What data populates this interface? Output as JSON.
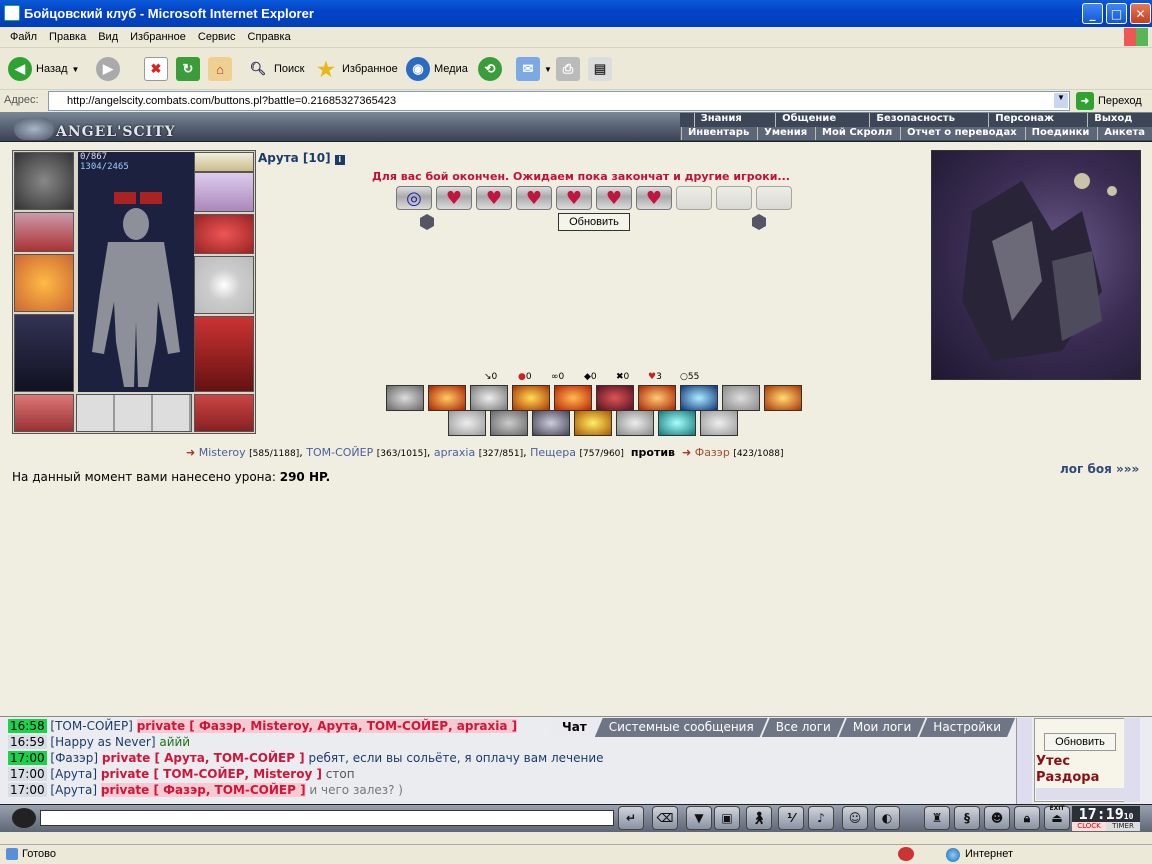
{
  "window": {
    "title": "Бойцовский клуб - Microsoft Internet Explorer"
  },
  "menu": [
    "Файл",
    "Правка",
    "Вид",
    "Избранное",
    "Сервис",
    "Справка"
  ],
  "toolbar": {
    "back": "Назад",
    "search": "Поиск",
    "favorites": "Избранное",
    "media": "Медиа"
  },
  "address": {
    "label": "Адрес:",
    "url": "http://angelscity.combats.com/buttons.pl?battle=0.21685327365423",
    "go": "Переход"
  },
  "game": {
    "logo": "ANGEL'SCITY",
    "nav_top": [
      "Знания",
      "Общение",
      "Безопасность",
      "Персонаж",
      "Выход"
    ],
    "nav_bottom": [
      "Инвентарь",
      "Умения",
      "Мой Скролл",
      "Отчет о переводах",
      "Поединки",
      "Анкета"
    ],
    "hp_line1": "0/867",
    "hp_line2": "1304/2465",
    "character": "Арута [10]",
    "battle_message": "Для вас бой окончен. Ожидаем пока закончат и другие игроки...",
    "refresh": "Обновить",
    "stats": [
      "0",
      "0",
      "0",
      "0",
      "0",
      "3",
      "55"
    ],
    "fighters": {
      "team1": [
        {
          "name": "Misteroy",
          "hp": "[585/1188]"
        },
        {
          "name": "ТОМ-СОЙЕР",
          "hp": "[363/1015]"
        },
        {
          "name": "apraxia",
          "hp": "[327/851]"
        },
        {
          "name": "Пещера",
          "hp": "[757/960]"
        }
      ],
      "vs": "против",
      "team2": [
        {
          "name": "Фазэр",
          "hp": "[423/1088]"
        }
      ]
    },
    "damage_label": "На данный момент вами нанесено урона:",
    "damage_value": "290 HP.",
    "log_link": "лог боя »»»"
  },
  "chat": {
    "tabs": [
      "Чат",
      "Системные сообщения",
      "Все логи",
      "Мои логи",
      "Настройки"
    ],
    "lines": [
      {
        "time": "16:58",
        "name": "[ТОМ-СОЙЕР]",
        "priv": "private [ Фазэр, Misteroy, Арута, ТОМ-СОЙЕР, apraxia ]",
        "text": ""
      },
      {
        "time": "16:59",
        "name": "[Happy as Never]",
        "priv": "",
        "text": "аййй"
      },
      {
        "time": "17:00",
        "name": "[Фазэр]",
        "priv": "private [ Арута, ТОМ-СОЙЕР ]",
        "text": "ребят, если вы сольёте, я оплачу вам лечение"
      },
      {
        "time": "17:00",
        "name": "[Арута]",
        "priv": "private [ ТОМ-СОЙЕР, Misteroy ]",
        "text": "стоп"
      },
      {
        "time": "17:00",
        "name": "[Арута]",
        "priv": "private [ Фазэр, ТОМ-СОЙЕР ]",
        "text": "и чего залез? )"
      }
    ],
    "refresh": "Обновить",
    "location_line1": "Утес",
    "location_line2": "Раздора",
    "clock": "17:19",
    "clock_seconds": "10",
    "clock_label": "CLOCK",
    "timer_label": "TIMER",
    "exit_label": "EXIT"
  },
  "status": {
    "left": "Готово",
    "zone": "Интернет"
  }
}
